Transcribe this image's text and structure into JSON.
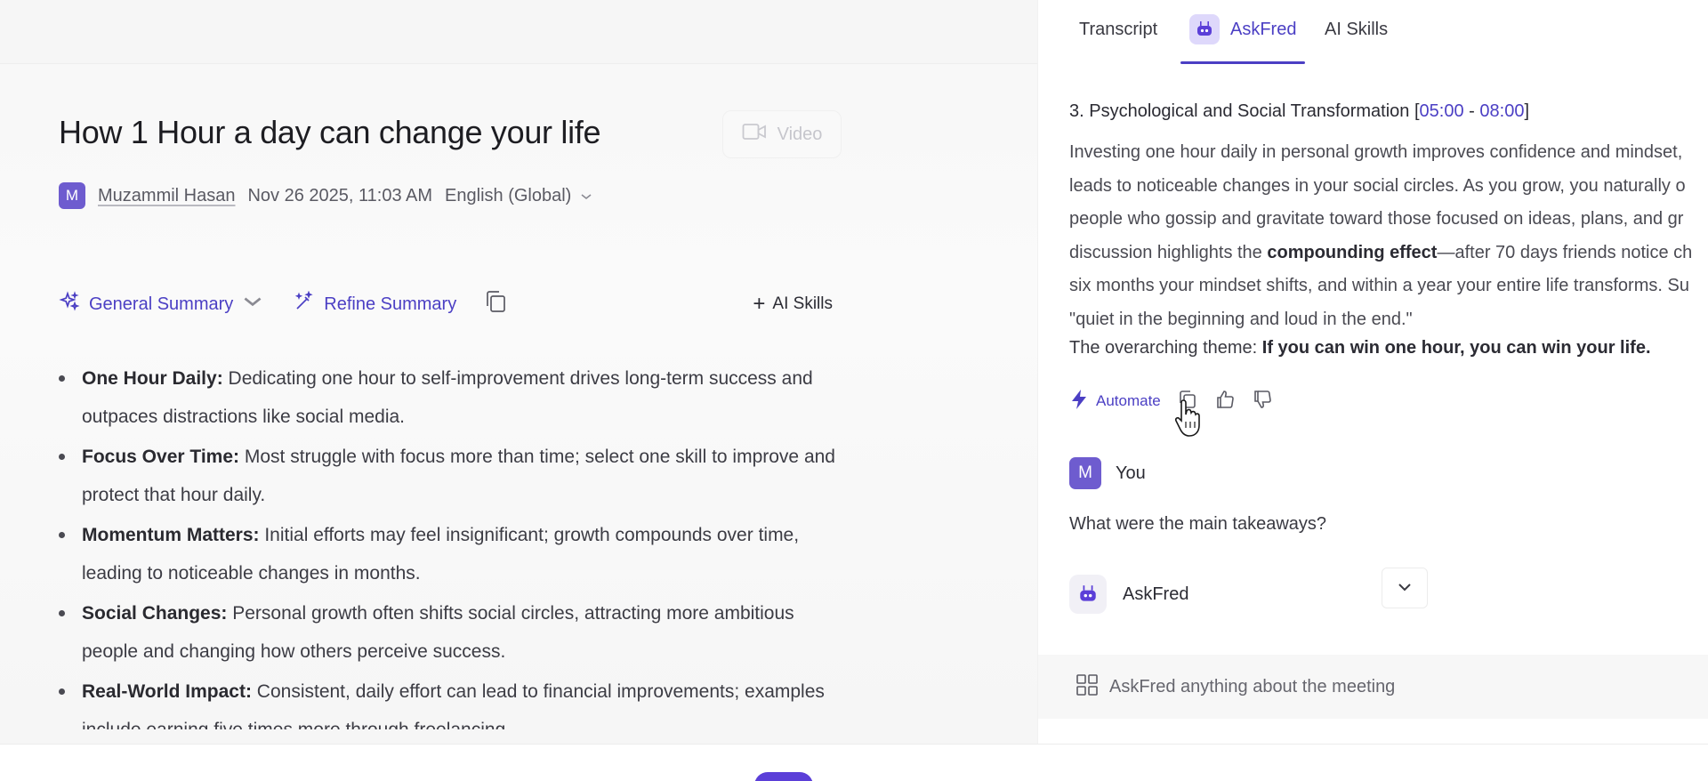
{
  "meeting": {
    "title": "How 1 Hour a day can change your life",
    "video_label": "Video",
    "author_initial": "M",
    "author_name": "Muzammil Hasan",
    "date": "Nov 26 2025, 11:03 AM",
    "language": "English (Global)"
  },
  "toolbar": {
    "general_summary": "General Summary",
    "refine_summary": "Refine Summary",
    "ai_skills": "AI Skills"
  },
  "summary_bullets": [
    {
      "label": "One Hour Daily:",
      "text": " Dedicating one hour to self-improvement drives long-term success and outpaces distractions like social media."
    },
    {
      "label": "Focus Over Time:",
      "text": " Most struggle with focus more than time; select one skill to improve and protect that hour daily."
    },
    {
      "label": "Momentum Matters:",
      "text": " Initial efforts may feel insignificant; growth compounds over time, leading to noticeable changes in months."
    },
    {
      "label": "Social Changes:",
      "text": " Personal growth often shifts social circles, attracting more ambitious people and changing how others perceive success."
    },
    {
      "label": "Real-World Impact:",
      "text": " Consistent, daily effort can lead to financial improvements; examples include earning five times more through freelancing."
    }
  ],
  "tabs": {
    "transcript": "Transcript",
    "askfred": "AskFred",
    "ai_skills": "AI Skills"
  },
  "chat": {
    "section_heading": "3. Psychological and Social Transformation",
    "ts_open": " [",
    "ts_start": "05:00",
    "ts_sep": " - ",
    "ts_end": "08:00",
    "ts_close": "]",
    "answer_lines": [
      "Investing one hour daily in personal growth improves confidence and mindset,",
      "leads to noticeable changes in your social circles. As you grow, you naturally o",
      "people who gossip and gravitate toward those focused on ideas, plans, and gr"
    ],
    "answer_line4_pre": "discussion highlights the ",
    "answer_line4_bold": "compounding effect",
    "answer_line4_post": "—after 70 days friends notice ch",
    "answer_line5": "six months your mindset shifts, and within a year your entire life transforms. Su",
    "answer_line6": "\"quiet in the beginning and loud in the end.\"",
    "theme_pre": "The overarching theme: ",
    "theme_bold": "If you can win one hour, you can win your life.",
    "automate_label": "Automate",
    "user_initial": "M",
    "user_label": "You",
    "user_question": "What were the main takeaways?",
    "bot_label": "AskFred",
    "composer_placeholder": "AskFred anything about the meeting"
  },
  "colors": {
    "accent": "#4b3fc4",
    "avatar": "#6e5ccf"
  }
}
